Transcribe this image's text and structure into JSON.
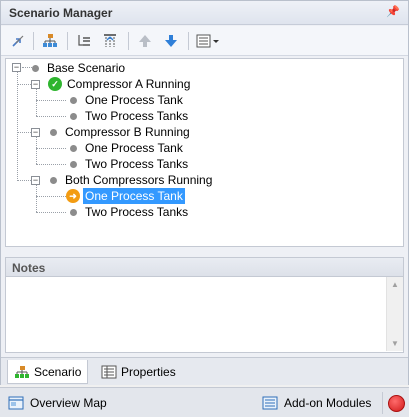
{
  "panel": {
    "title": "Scenario Manager",
    "pin_icon": "pin-icon"
  },
  "toolbar": {
    "buttons": [
      {
        "name": "promote-scenario-button",
        "icon": "arrows-icon"
      },
      {
        "name": "tree-structure-button",
        "icon": "hierarchy-icon"
      },
      {
        "name": "child-scenario-button",
        "icon": "child-list-icon"
      },
      {
        "name": "filter-scenario-button",
        "icon": "filter-tree-icon"
      },
      {
        "name": "move-up-button",
        "icon": "arrow-up-icon"
      },
      {
        "name": "move-down-button",
        "icon": "arrow-down-icon"
      },
      {
        "name": "view-options-button",
        "icon": "list-view-icon"
      }
    ]
  },
  "tree": {
    "root": "Base Scenario",
    "groups": [
      {
        "label": "Compressor A Running",
        "status": "check",
        "children": [
          "One Process Tank",
          "Two Process Tanks"
        ]
      },
      {
        "label": "Compressor B Running",
        "status": "none",
        "children": [
          "One Process Tank",
          "Two Process Tanks"
        ]
      },
      {
        "label": "Both Compressors Running",
        "status": "none",
        "children": [
          "One Process Tank",
          "Two Process Tanks"
        ]
      }
    ],
    "selected": "One Process Tank"
  },
  "notes": {
    "title": "Notes",
    "value": ""
  },
  "tabs": [
    {
      "label": "Scenario",
      "active": true,
      "icon": "scenario-tree-icon"
    },
    {
      "label": "Properties",
      "active": false,
      "icon": "properties-icon"
    }
  ],
  "bottom": {
    "overview_map": "Overview Map",
    "addon_modules": "Add-on Modules"
  },
  "colors": {
    "selection": "#3399ff",
    "check": "#2fb52f",
    "current": "#f39c12",
    "arrow_blue": "#2f7fd8",
    "stop": "#e02020"
  }
}
